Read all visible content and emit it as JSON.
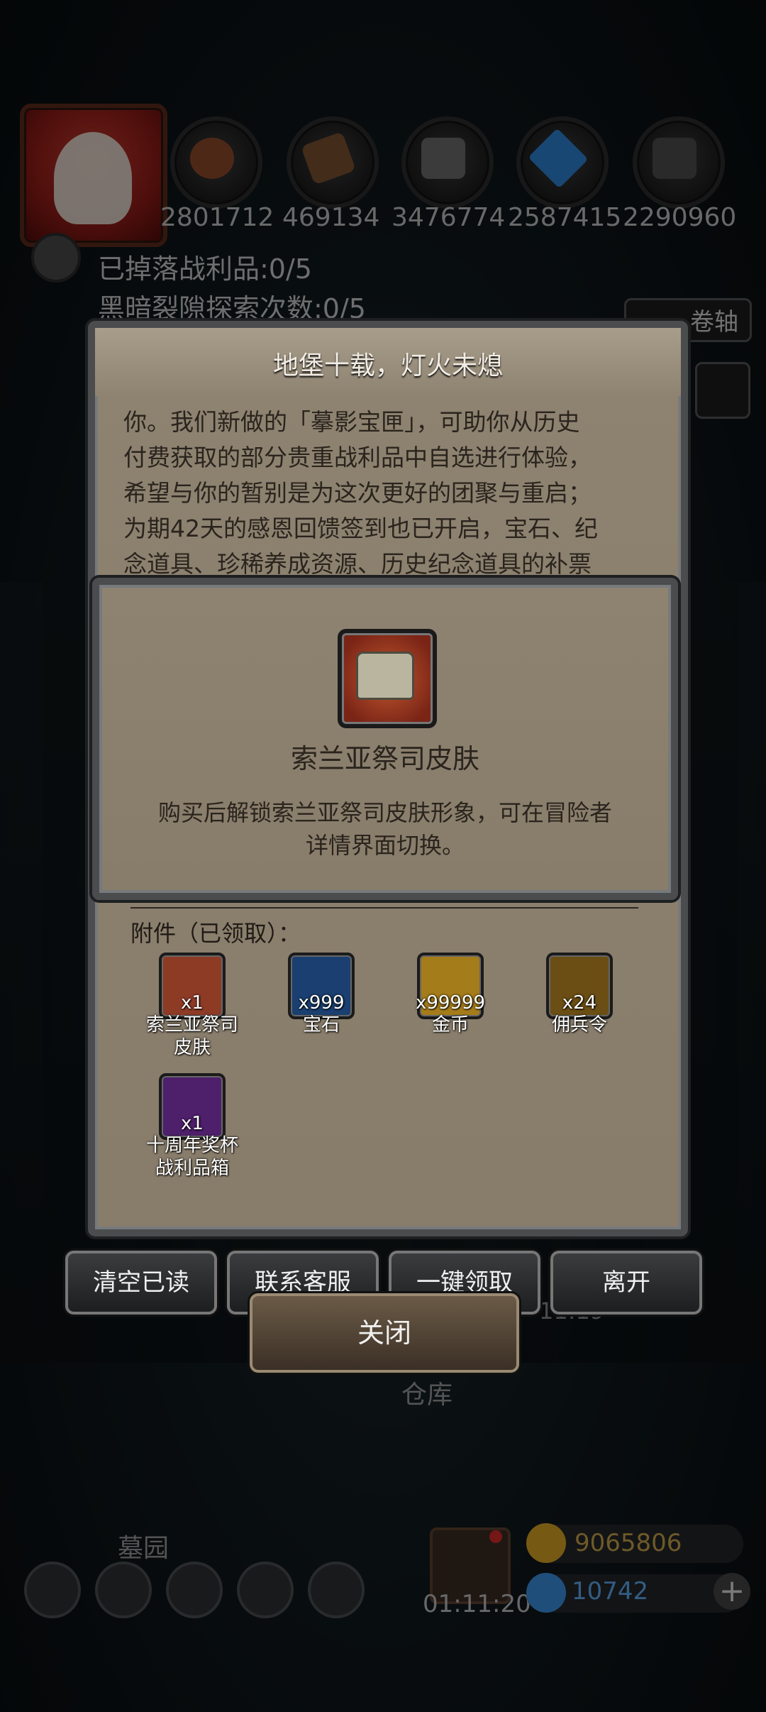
{
  "hud": {
    "resources": [
      {
        "icon": "meat-icon",
        "value": "2801712",
        "color": "#a0522d"
      },
      {
        "icon": "wood-icon",
        "value": "469134",
        "color": "#8b5a2b"
      },
      {
        "icon": "iron-icon",
        "value": "3476774",
        "color": "#7d7d7d"
      },
      {
        "icon": "crystal-icon",
        "value": "2587415",
        "color": "#3d8fe0"
      },
      {
        "icon": "stone-icon",
        "value": "2290960",
        "color": "#5e5e5e"
      }
    ],
    "loot_dropped": "已掉落战利品:0/5",
    "rift_explore": "黑暗裂隙探索次数:0/5",
    "scroll_button": "卷轴"
  },
  "letter": {
    "title": "地堡十载，灯火未熄",
    "lines": [
      "你。我们新做的「摹影宝匣」，可助你从历史",
      "付费获取的部分贵重战利品中自选进行体验，",
      "希望与你的暂别是为这次更好的团聚与重启；",
      "为期42天的感恩回馈签到也已开启，宝石、纪",
      "念道具、珍稀养成资源、历史纪念道具的补票"
    ],
    "attachments_label": "附件（已领取）：",
    "attachments": [
      {
        "icon": "chest-icon",
        "qty": "x1",
        "name_line1": "索兰亚祭司",
        "name_line2": "皮肤",
        "color": "#b0452c"
      },
      {
        "icon": "gem-icon",
        "qty": "x999",
        "name_line1": "宝石",
        "name_line2": "",
        "color": "#2f7fd8"
      },
      {
        "icon": "gold-coin-icon",
        "qty": "x99999",
        "name_line1": "金币",
        "name_line2": "",
        "color": "#d7a526"
      },
      {
        "icon": "mercenary-token-icon",
        "qty": "x24",
        "name_line1": "佣兵令",
        "name_line2": "",
        "color": "#c9a02a"
      },
      {
        "icon": "trophy-chest-icon",
        "qty": "x1",
        "name_line1": "十周年奖杯",
        "name_line2": "战利品箱",
        "color": "#6a2a8f"
      }
    ]
  },
  "popup": {
    "item_name": "索兰亚祭司皮肤",
    "desc_line1": "购买后解锁索兰亚祭司皮肤形象，可在冒险者",
    "desc_line2": "详情界面切换。"
  },
  "buttons": {
    "clear_read": "清空已读",
    "contact_service": "联系客服",
    "claim_all": "一键领取",
    "leave": "离开",
    "close": "关闭"
  },
  "bottom": {
    "warehouse": "仓库",
    "cemetery": "墓园",
    "gift_timer": "01:11:20",
    "gold_amount": "9065806",
    "gem_amount": "10742",
    "time_hint": "11:19"
  }
}
